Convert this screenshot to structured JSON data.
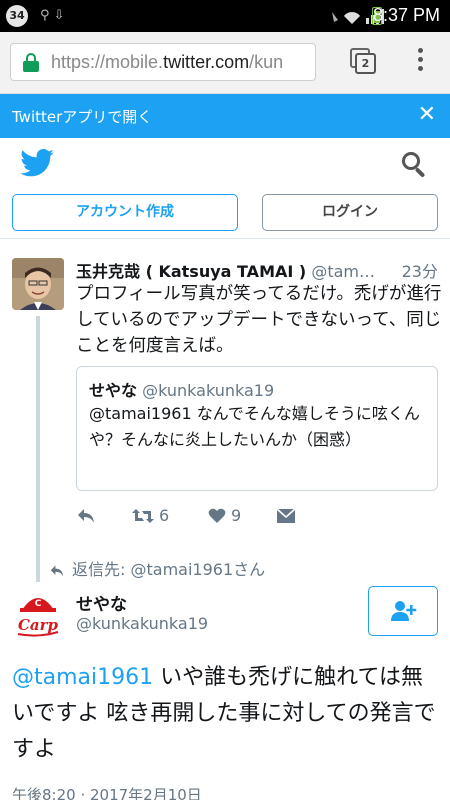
{
  "status_bar": {
    "badge": "34",
    "time": "8:37 PM",
    "icons": [
      "usb-icon",
      "mute-icon",
      "wifi-icon",
      "signal-icon",
      "battery-icon"
    ]
  },
  "browser": {
    "url_prefix": "https://mobile.",
    "url_domain": "twitter.com",
    "url_suffix": "/kun",
    "tab_count": "2"
  },
  "banner": {
    "label": "Twitterアプリで開く"
  },
  "header": {
    "signup_label": "アカウント作成",
    "login_label": "ログイン"
  },
  "parent_tweet": {
    "name": "玉井克哉 ( Katsuya TAMAI )",
    "handle": "@tam…",
    "time": "23分",
    "text": "プロフィール写真が笑ってるだけ。禿げが進行しているのでアップデートできないって、同じことを何度言えば。",
    "quote": {
      "name": "せやな",
      "handle": "@kunkakunka19",
      "text": "@tamai1961 なんでそんな嬉しそうに呟くんや？そんなに炎上したいんか（困惑）"
    },
    "retweets": "6",
    "likes": "9"
  },
  "reply_to": {
    "label": "返信先:",
    "handle": "@tamai1961さん"
  },
  "main_tweet": {
    "name": "せやな",
    "handle": "@kunkakunka19",
    "mention": "@tamai1961",
    "text": " いや誰も禿げに触れては無いですよ 呟き再開した事に対しての発言ですよ",
    "date": "午後8:20 · 2017年2月10日",
    "avatar_text": "Carp"
  },
  "colors": {
    "twitter_blue": "#1da1f2",
    "carp_red": "#d7191f"
  }
}
